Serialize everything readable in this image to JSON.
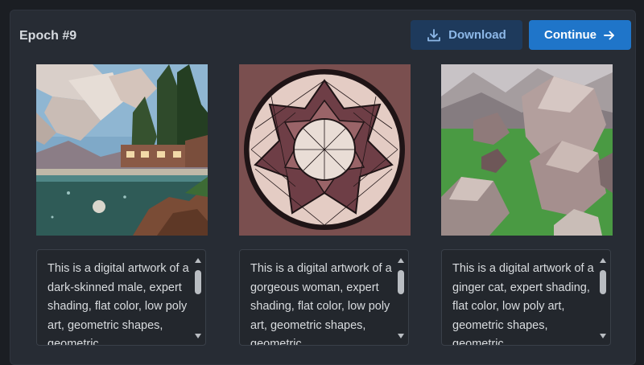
{
  "header": {
    "title": "Epoch #9"
  },
  "toolbar": {
    "download_label": "Download",
    "continue_label": "Continue",
    "download_icon": "download-icon",
    "continue_icon": "arrow-right-icon"
  },
  "colors": {
    "panel": "#272c34",
    "download_bg": "#1e3a5c",
    "continue_bg": "#1f75c9"
  },
  "cards": [
    {
      "caption": "This is a digital artwork of a dark-skinned male, expert shading, flat color, low poly art, geometric shapes, geometric"
    },
    {
      "caption": "This is a digital artwork of a gorgeous woman, expert shading, flat color, low poly art, geometric shapes, geometric"
    },
    {
      "caption": "This is a digital artwork of a ginger cat, expert shading, flat color, low poly art, geometric shapes, geometric"
    }
  ]
}
